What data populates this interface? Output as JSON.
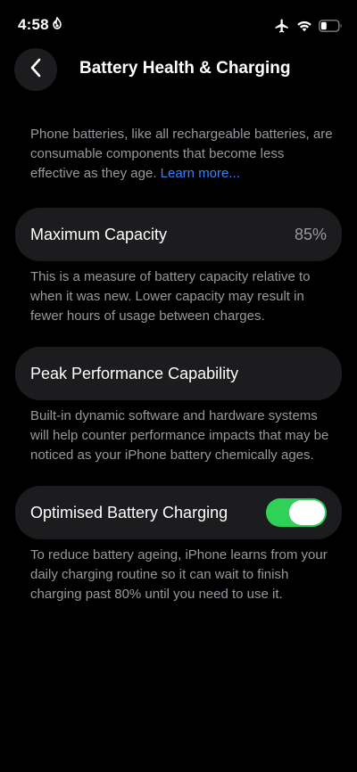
{
  "status_bar": {
    "time": "4:58",
    "icons": [
      "focus-icon",
      "airplane-icon",
      "wifi-icon",
      "battery-icon"
    ]
  },
  "nav": {
    "back_icon": "chevron-left-icon",
    "title": "Battery Health & Charging"
  },
  "intro": {
    "text": "Phone batteries, like all rechargeable batteries, are consumable components that become less effective as they age. ",
    "link": "Learn more..."
  },
  "maximum_capacity": {
    "label": "Maximum Capacity",
    "value": "85%",
    "footer": "This is a measure of battery capacity relative to when it was new. Lower capacity may result in fewer hours of usage between charges."
  },
  "peak_performance": {
    "label": "Peak Performance Capability",
    "footer": "Built-in dynamic software and hardware systems will help counter performance impacts that may be noticed as your iPhone battery chemically ages."
  },
  "optimised_charging": {
    "label": "Optimised Battery Charging",
    "enabled": true,
    "footer": "To reduce battery ageing, iPhone learns from your daily charging routine so it can wait to finish charging past 80% until you need to use it."
  },
  "colors": {
    "background": "#000000",
    "card": "#1c1c1e",
    "secondary_text": "#98989f",
    "link": "#3a82f7",
    "toggle_on": "#30d158"
  }
}
